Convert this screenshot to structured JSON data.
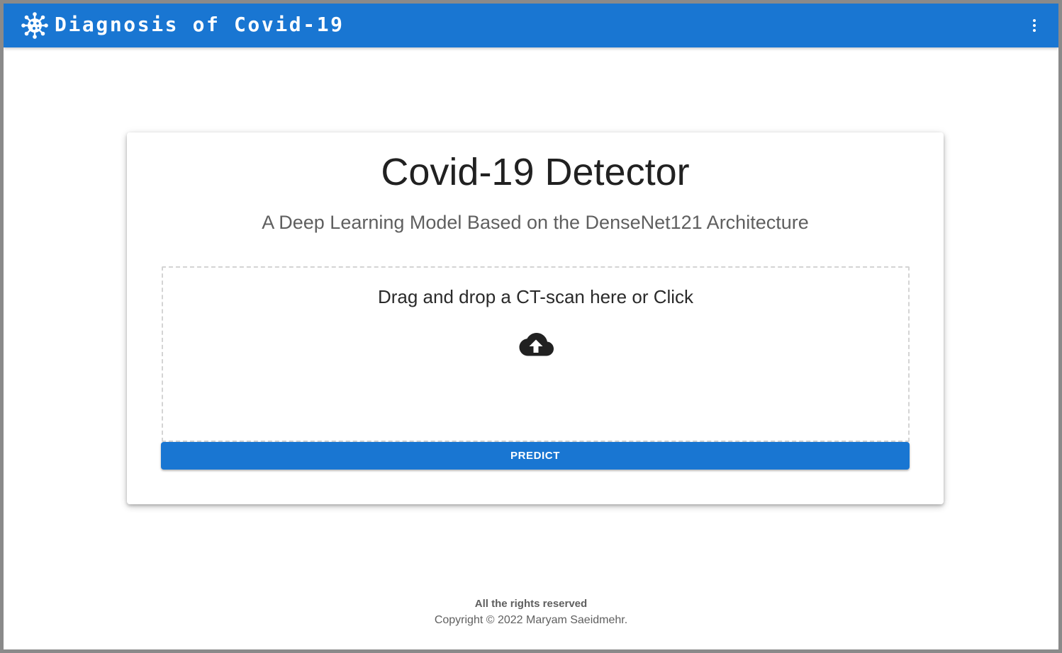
{
  "appbar": {
    "title": "Diagnosis of Covid-19",
    "logo_icon": "virus-icon",
    "menu_icon": "more-vert-icon",
    "background_color": "#1976d2"
  },
  "card": {
    "title": "Covid-19 Detector",
    "subtitle": "A Deep Learning Model Based on the DenseNet121 Architecture"
  },
  "dropzone": {
    "text": "Drag and drop a CT-scan here or Click",
    "icon": "cloud-upload-icon"
  },
  "predict_button": {
    "label": "PREDICT",
    "color": "#1976d2"
  },
  "footer": {
    "rights": "All the rights reserved",
    "copyright": "Copyright © 2022 Maryam Saeidmehr."
  }
}
